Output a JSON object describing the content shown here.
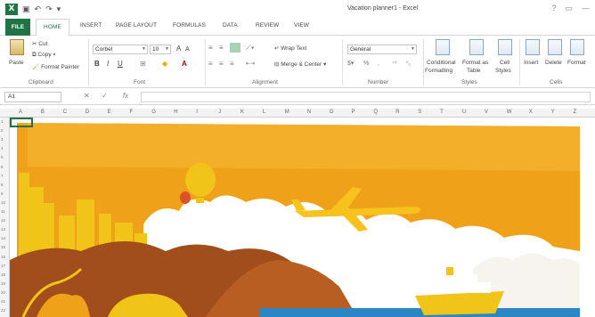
{
  "window": {
    "title": "Vacation planner1 - Excel",
    "app_icon_letter": "X"
  },
  "tabs": [
    "FILE",
    "HOME",
    "INSERT",
    "PAGE LAYOUT",
    "FORMULAS",
    "DATA",
    "REVIEW",
    "VIEW"
  ],
  "clipboard": {
    "paste": "Paste",
    "cut": "Cut",
    "copy": "Copy",
    "format_painter": "Format Painter",
    "label": "Clipboard"
  },
  "font": {
    "name": "Corbel",
    "size": "10",
    "bold": "B",
    "italic": "I",
    "underline": "U",
    "grow": "A",
    "shrink": "A",
    "label": "Font"
  },
  "alignment": {
    "wrap_text": "Wrap Text",
    "merge_center": "Merge & Center",
    "label": "Alignment"
  },
  "number": {
    "format": "General",
    "label": "Number"
  },
  "styles": {
    "conditional": [
      "Conditional",
      "Formatting"
    ],
    "format_table": [
      "Format as",
      "Table"
    ],
    "cell_styles": [
      "Cell",
      "Styles"
    ],
    "label": "Styles"
  },
  "cells": {
    "insert": "Insert",
    "delete": "Delete",
    "format": "Format",
    "label": "Cells"
  },
  "formula_bar": {
    "name_box": "A1",
    "fx": "fx",
    "cancel": "✕",
    "enter": "✓"
  },
  "columns": [
    "A",
    "B",
    "C",
    "D",
    "E",
    "F",
    "G",
    "H",
    "I",
    "J",
    "K",
    "L",
    "M",
    "N",
    "O",
    "P",
    "Q",
    "R",
    "S",
    "T",
    "U",
    "V",
    "W",
    "X",
    "Y",
    "Z"
  ],
  "rows": [
    "1",
    "2",
    "3",
    "4",
    "5",
    "6",
    "7",
    "8",
    "9",
    "10",
    "11",
    "12",
    "13",
    "14",
    "15",
    "16",
    "17",
    "18",
    "19",
    "20",
    "21",
    "22"
  ],
  "colors": {
    "excel_green": "#217346",
    "sky_orange": "#f0a11a",
    "cloud": "#ffffff",
    "plane_yellow": "#f6c21b",
    "city_yellow": "#f0c419",
    "mountain_brown": "#9a4a1a",
    "sea_blue": "#2d86c4"
  }
}
